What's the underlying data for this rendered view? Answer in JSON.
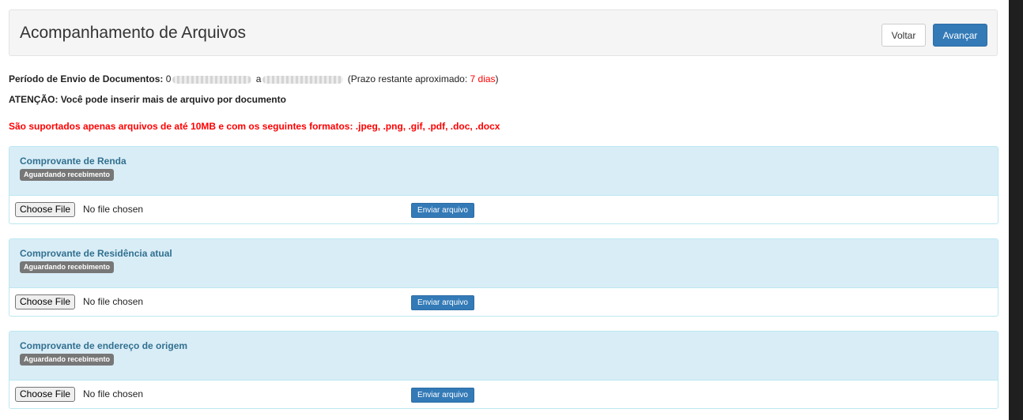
{
  "header": {
    "title": "Acompanhamento de Arquivos",
    "back_label": "Voltar",
    "next_label": "Avançar"
  },
  "info": {
    "period_label": "Período de Envio de Documentos:",
    "period_start_visible": "0",
    "period_separator": "a",
    "deadline_prefix": "(Prazo restante aproximado:",
    "deadline_value": "7 dias",
    "deadline_suffix": ")",
    "attention": "ATENÇÃO: Você pode inserir mais de arquivo por documento",
    "supported_formats": "São suportados apenas arquivos de até 10MB e com os seguintes formatos: .jpeg, .png, .gif, .pdf, .doc, .docx"
  },
  "documents": [
    {
      "title": "Comprovante de Renda",
      "status": "Aguardando recebimento",
      "choose_label": "Choose File",
      "file_status": "No file chosen",
      "send_label": "Enviar arquivo"
    },
    {
      "title": "Comprovante de Residência atual",
      "status": "Aguardando recebimento",
      "choose_label": "Choose File",
      "file_status": "No file chosen",
      "send_label": "Enviar arquivo"
    },
    {
      "title": "Comprovante de endereço de origem",
      "status": "Aguardando recebimento",
      "choose_label": "Choose File",
      "file_status": "No file chosen",
      "send_label": "Enviar arquivo"
    }
  ],
  "colors": {
    "primary": "#337ab7",
    "panel_heading": "#d9edf7",
    "panel_title": "#31708f",
    "warning": "#ff0000",
    "badge": "#777777"
  }
}
